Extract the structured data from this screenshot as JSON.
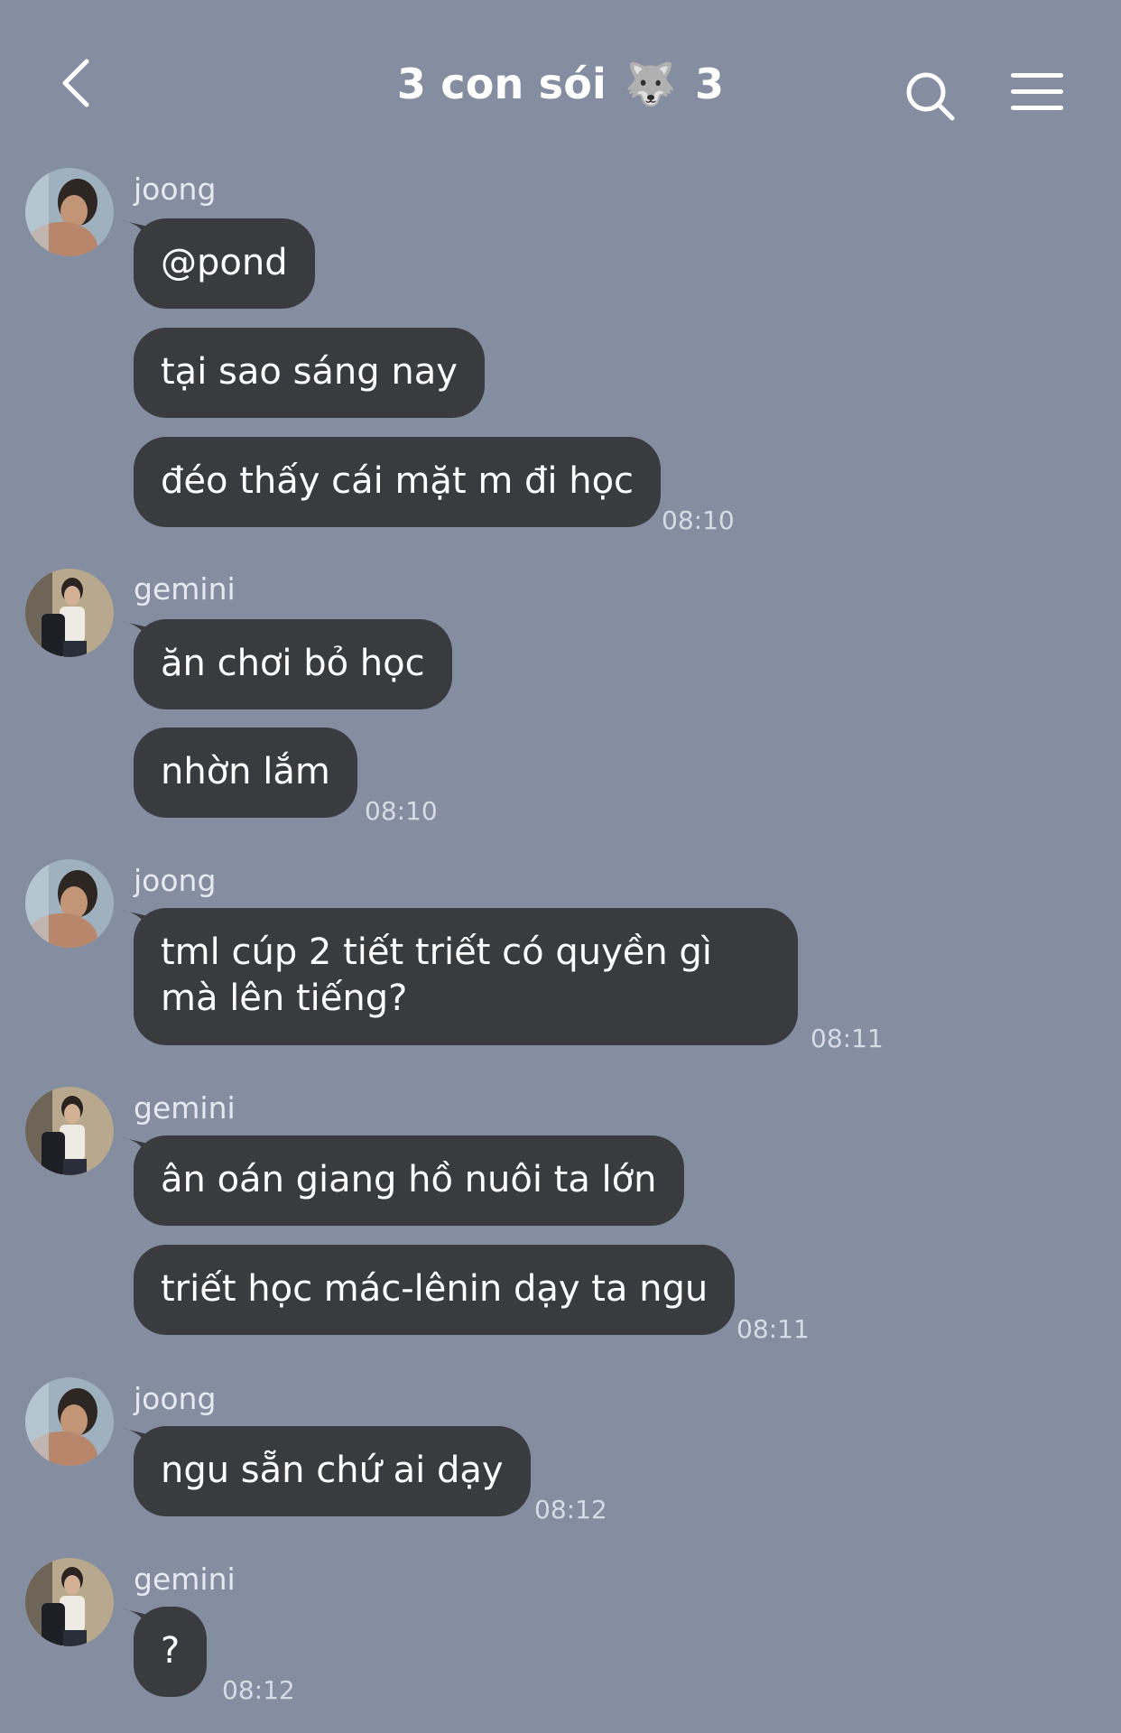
{
  "header": {
    "title": "3 con sói",
    "title_emoji": "🐺",
    "member_count": "3"
  },
  "messages": [
    {
      "sender": "joong",
      "lines": [
        "@pond",
        "tại sao sáng nay",
        "đéo thấy cái mặt m đi học"
      ],
      "time": "08:10"
    },
    {
      "sender": "gemini",
      "lines": [
        "ăn chơi bỏ học",
        "nhờn lắm"
      ],
      "time": "08:10"
    },
    {
      "sender": "joong",
      "lines": [
        "tml cúp 2 tiết triết có quyền gì mà lên tiếng?"
      ],
      "time": "08:11"
    },
    {
      "sender": "gemini",
      "lines": [
        "ân oán giang hồ nuôi ta lớn",
        "triết học mác-lênin dạy ta ngu"
      ],
      "time": "08:11"
    },
    {
      "sender": "joong",
      "lines": [
        "ngu sẵn chứ ai dạy"
      ],
      "time": "08:12"
    },
    {
      "sender": "gemini",
      "lines": [
        "?"
      ],
      "time": "08:12"
    }
  ],
  "colors": {
    "background": "#858EA0",
    "bubble": "#3A3B3F",
    "text": "#FFFFFF",
    "meta_text": "#D7DBE3"
  },
  "icons": [
    "back-arrow-icon",
    "search-icon",
    "menu-icon"
  ]
}
